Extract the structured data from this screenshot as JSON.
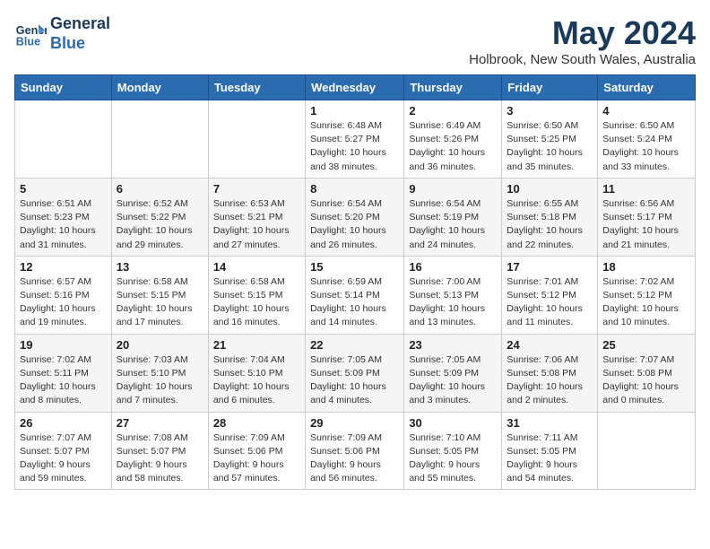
{
  "header": {
    "logo_line1": "General",
    "logo_line2": "Blue",
    "month": "May 2024",
    "location": "Holbrook, New South Wales, Australia"
  },
  "days_of_week": [
    "Sunday",
    "Monday",
    "Tuesday",
    "Wednesday",
    "Thursday",
    "Friday",
    "Saturday"
  ],
  "weeks": [
    [
      {
        "day": "",
        "detail": ""
      },
      {
        "day": "",
        "detail": ""
      },
      {
        "day": "",
        "detail": ""
      },
      {
        "day": "1",
        "detail": "Sunrise: 6:48 AM\nSunset: 5:27 PM\nDaylight: 10 hours\nand 38 minutes."
      },
      {
        "day": "2",
        "detail": "Sunrise: 6:49 AM\nSunset: 5:26 PM\nDaylight: 10 hours\nand 36 minutes."
      },
      {
        "day": "3",
        "detail": "Sunrise: 6:50 AM\nSunset: 5:25 PM\nDaylight: 10 hours\nand 35 minutes."
      },
      {
        "day": "4",
        "detail": "Sunrise: 6:50 AM\nSunset: 5:24 PM\nDaylight: 10 hours\nand 33 minutes."
      }
    ],
    [
      {
        "day": "5",
        "detail": "Sunrise: 6:51 AM\nSunset: 5:23 PM\nDaylight: 10 hours\nand 31 minutes."
      },
      {
        "day": "6",
        "detail": "Sunrise: 6:52 AM\nSunset: 5:22 PM\nDaylight: 10 hours\nand 29 minutes."
      },
      {
        "day": "7",
        "detail": "Sunrise: 6:53 AM\nSunset: 5:21 PM\nDaylight: 10 hours\nand 27 minutes."
      },
      {
        "day": "8",
        "detail": "Sunrise: 6:54 AM\nSunset: 5:20 PM\nDaylight: 10 hours\nand 26 minutes."
      },
      {
        "day": "9",
        "detail": "Sunrise: 6:54 AM\nSunset: 5:19 PM\nDaylight: 10 hours\nand 24 minutes."
      },
      {
        "day": "10",
        "detail": "Sunrise: 6:55 AM\nSunset: 5:18 PM\nDaylight: 10 hours\nand 22 minutes."
      },
      {
        "day": "11",
        "detail": "Sunrise: 6:56 AM\nSunset: 5:17 PM\nDaylight: 10 hours\nand 21 minutes."
      }
    ],
    [
      {
        "day": "12",
        "detail": "Sunrise: 6:57 AM\nSunset: 5:16 PM\nDaylight: 10 hours\nand 19 minutes."
      },
      {
        "day": "13",
        "detail": "Sunrise: 6:58 AM\nSunset: 5:15 PM\nDaylight: 10 hours\nand 17 minutes."
      },
      {
        "day": "14",
        "detail": "Sunrise: 6:58 AM\nSunset: 5:15 PM\nDaylight: 10 hours\nand 16 minutes."
      },
      {
        "day": "15",
        "detail": "Sunrise: 6:59 AM\nSunset: 5:14 PM\nDaylight: 10 hours\nand 14 minutes."
      },
      {
        "day": "16",
        "detail": "Sunrise: 7:00 AM\nSunset: 5:13 PM\nDaylight: 10 hours\nand 13 minutes."
      },
      {
        "day": "17",
        "detail": "Sunrise: 7:01 AM\nSunset: 5:12 PM\nDaylight: 10 hours\nand 11 minutes."
      },
      {
        "day": "18",
        "detail": "Sunrise: 7:02 AM\nSunset: 5:12 PM\nDaylight: 10 hours\nand 10 minutes."
      }
    ],
    [
      {
        "day": "19",
        "detail": "Sunrise: 7:02 AM\nSunset: 5:11 PM\nDaylight: 10 hours\nand 8 minutes."
      },
      {
        "day": "20",
        "detail": "Sunrise: 7:03 AM\nSunset: 5:10 PM\nDaylight: 10 hours\nand 7 minutes."
      },
      {
        "day": "21",
        "detail": "Sunrise: 7:04 AM\nSunset: 5:10 PM\nDaylight: 10 hours\nand 6 minutes."
      },
      {
        "day": "22",
        "detail": "Sunrise: 7:05 AM\nSunset: 5:09 PM\nDaylight: 10 hours\nand 4 minutes."
      },
      {
        "day": "23",
        "detail": "Sunrise: 7:05 AM\nSunset: 5:09 PM\nDaylight: 10 hours\nand 3 minutes."
      },
      {
        "day": "24",
        "detail": "Sunrise: 7:06 AM\nSunset: 5:08 PM\nDaylight: 10 hours\nand 2 minutes."
      },
      {
        "day": "25",
        "detail": "Sunrise: 7:07 AM\nSunset: 5:08 PM\nDaylight: 10 hours\nand 0 minutes."
      }
    ],
    [
      {
        "day": "26",
        "detail": "Sunrise: 7:07 AM\nSunset: 5:07 PM\nDaylight: 9 hours\nand 59 minutes."
      },
      {
        "day": "27",
        "detail": "Sunrise: 7:08 AM\nSunset: 5:07 PM\nDaylight: 9 hours\nand 58 minutes."
      },
      {
        "day": "28",
        "detail": "Sunrise: 7:09 AM\nSunset: 5:06 PM\nDaylight: 9 hours\nand 57 minutes."
      },
      {
        "day": "29",
        "detail": "Sunrise: 7:09 AM\nSunset: 5:06 PM\nDaylight: 9 hours\nand 56 minutes."
      },
      {
        "day": "30",
        "detail": "Sunrise: 7:10 AM\nSunset: 5:05 PM\nDaylight: 9 hours\nand 55 minutes."
      },
      {
        "day": "31",
        "detail": "Sunrise: 7:11 AM\nSunset: 5:05 PM\nDaylight: 9 hours\nand 54 minutes."
      },
      {
        "day": "",
        "detail": ""
      }
    ]
  ]
}
